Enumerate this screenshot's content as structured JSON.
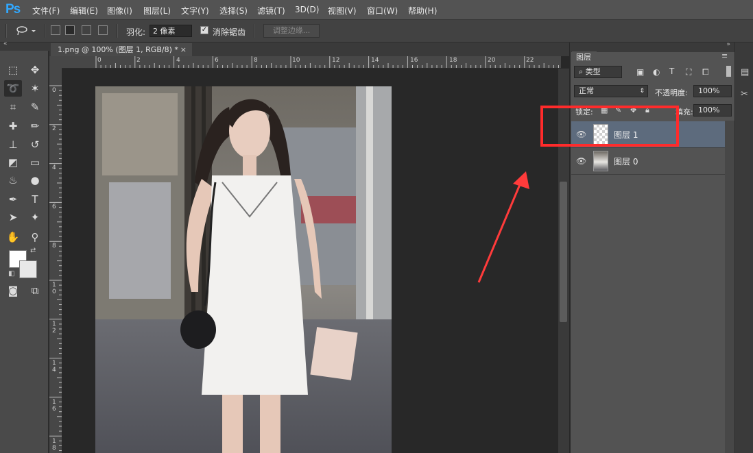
{
  "app": {
    "logo": "Ps"
  },
  "menu": [
    "文件(F)",
    "编辑(E)",
    "图像(I)",
    "图层(L)",
    "文字(Y)",
    "选择(S)",
    "滤镜(T)",
    "3D(D)",
    "视图(V)",
    "窗口(W)",
    "帮助(H)"
  ],
  "options": {
    "feather_label": "羽化:",
    "feather_value": "2 像素",
    "anti_alias_label": "消除锯齿",
    "anti_alias_checked": true,
    "refine_edge_label": "调整边缘..."
  },
  "document": {
    "tab_title": "1.png @ 100% (图层 1, RGB/8) *",
    "close": "×"
  },
  "rulers": {
    "horizontal": [
      "0",
      "2",
      "4",
      "6",
      "8",
      "10",
      "12",
      "14",
      "16",
      "18",
      "20",
      "22"
    ],
    "vertical": [
      "0",
      "2",
      "4",
      "6",
      "8",
      "1 0",
      "1 2",
      "1 4",
      "1 6",
      "1 8"
    ]
  },
  "layers_panel": {
    "tab_label": "图层",
    "filter_kind": "类型",
    "blend_mode": "正常",
    "opacity_label": "不透明度:",
    "opacity_value": "100%",
    "lock_label": "锁定:",
    "fill_label": "填充:",
    "fill_value": "100%",
    "layers": [
      {
        "name": "图层 1",
        "selected": true,
        "visible": true
      },
      {
        "name": "图层 0",
        "selected": false,
        "visible": true
      }
    ]
  },
  "colors": {
    "accent_logo": "#31a8ff",
    "highlight_box": "#ff2b2b",
    "arrow": "#ff3b3b",
    "selected_layer": "#5d6b7d"
  }
}
